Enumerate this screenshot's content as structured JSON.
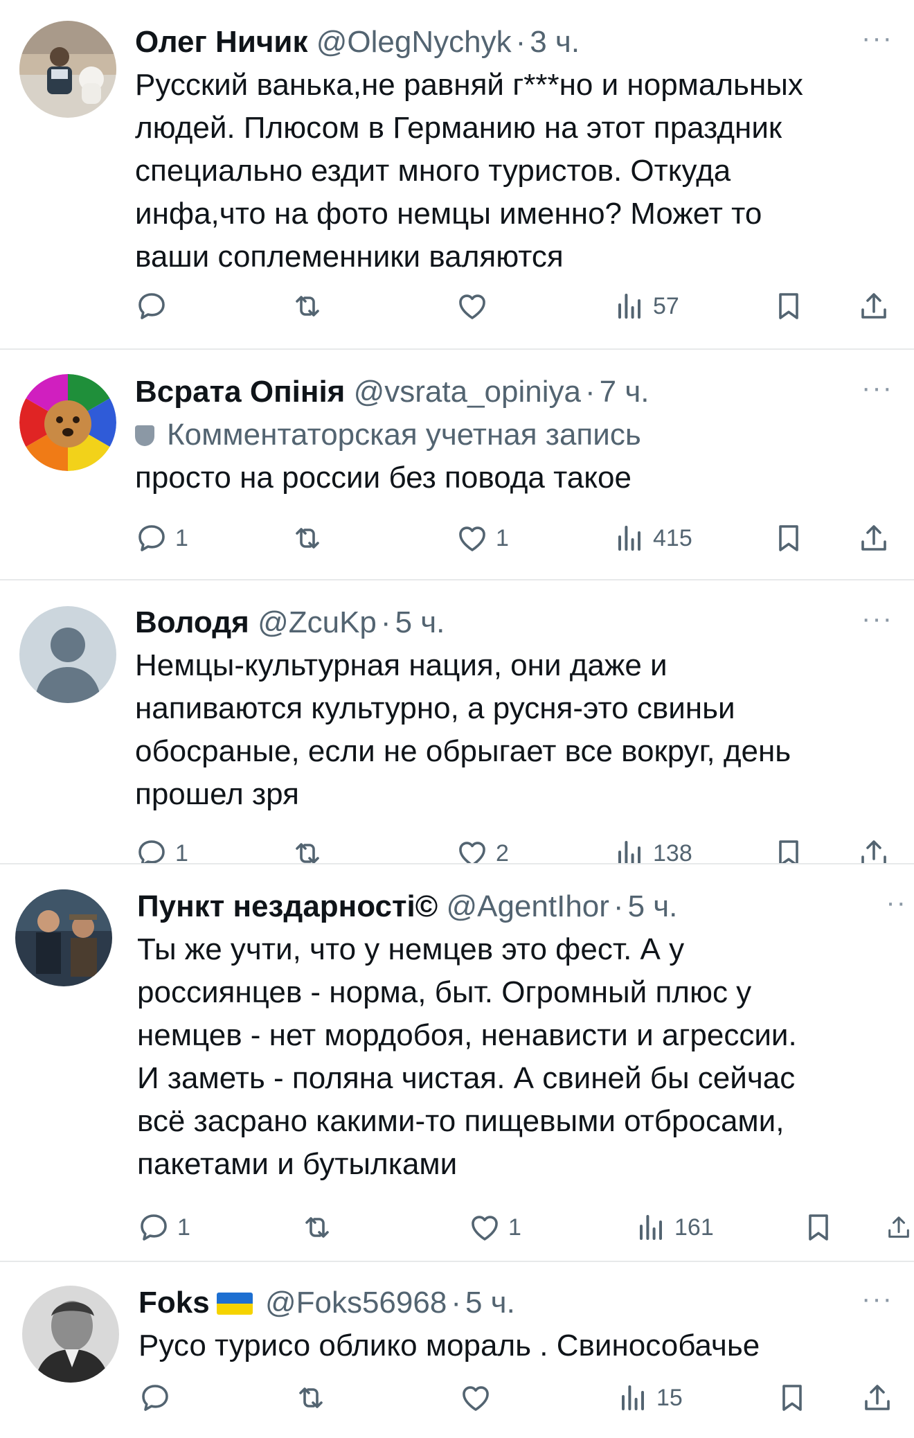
{
  "tweets": [
    {
      "name": "Олег Ничик",
      "handle": "@OlegNychyk",
      "time": "3 ч.",
      "more": "···",
      "lines": [
        "Русский ванька,не равняй г***но и нормальных",
        "людей. Плюсом в Германию на этот праздник",
        "специально ездит много туристов. Откуда",
        "инфа,что на фото немцы именно? Может то",
        "ваши соплеменники валяются"
      ],
      "replies": "",
      "retweets": "",
      "likes": "",
      "views": "57"
    },
    {
      "name": "Всрата Опінія",
      "handle": "@vsrata_opiniya",
      "time": "7 ч.",
      "more": "···",
      "community": "Комментаторская учетная запись",
      "lines": [
        "просто на россии без повода такое"
      ],
      "replies": "1",
      "retweets": "",
      "likes": "1",
      "views": "415"
    },
    {
      "name": "Володя",
      "handle": "@ZcuKp",
      "time": "5 ч.",
      "more": "···",
      "lines": [
        "Немцы-культурная нация, они даже и",
        "напиваются культурно, а русня-это свиньи",
        "обосраные, если не обрыгает все вокруг, день",
        "прошел зря"
      ],
      "replies": "1",
      "retweets": "",
      "likes": "2",
      "views": "138"
    },
    {
      "name": "Пункт нездарності©",
      "handle": "@AgentIhor",
      "time": "5 ч.",
      "more": "··",
      "lines": [
        "Ты же учти, что у немцев это фест. А у",
        "россиянцев - норма, быт. Огромный плюс у",
        "немцев - нет мордобоя, ненависти и агрессии.",
        "И заметь - поляна чистая. А свиней бы сейчас",
        "всё засрано какими-то пищевыми отбросами,",
        "пакетами и бутылками"
      ],
      "replies": "1",
      "retweets": "",
      "likes": "1",
      "views": "161"
    },
    {
      "name": "Foks",
      "handle": "@Foks56968",
      "time": "5 ч.",
      "more": "···",
      "flag": "ukraine-flag",
      "lines": [
        "Русо турисо облико мораль . Свинособачье"
      ],
      "replies": "",
      "retweets": "",
      "likes": "",
      "views": "15"
    }
  ],
  "icons": {
    "reply": "reply-icon",
    "retweet": "retweet-icon",
    "like": "like-icon",
    "views": "views-icon",
    "bookmark": "bookmark-icon",
    "share": "share-icon"
  },
  "colors": {
    "text": "#0f1419",
    "secondary": "#536471",
    "divider": "#e7e9ea"
  }
}
